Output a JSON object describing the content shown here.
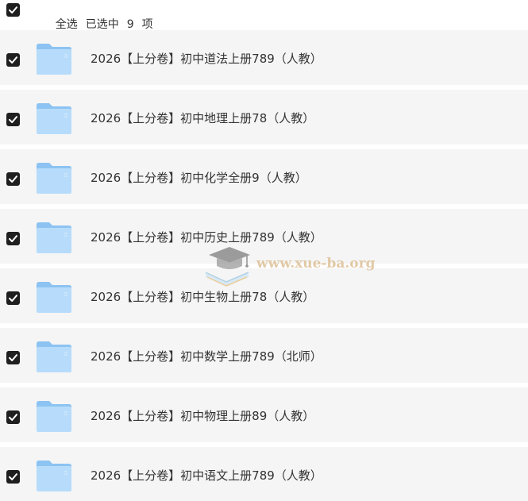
{
  "header": {
    "select_all": "全选",
    "selected": "已选中",
    "count": "9",
    "unit": "项"
  },
  "files": [
    {
      "name": "2026【上分卷】初中道法上册789（人教）",
      "checked": true
    },
    {
      "name": "2026【上分卷】初中地理上册78（人教）",
      "checked": true
    },
    {
      "name": "2026【上分卷】初中化学全册9（人教）",
      "checked": true
    },
    {
      "name": "2026【上分卷】初中历史上册789（人教）",
      "checked": true
    },
    {
      "name": "2026【上分卷】初中生物上册78（人教）",
      "checked": true
    },
    {
      "name": "2026【上分卷】初中数学上册789（北师）",
      "checked": true
    },
    {
      "name": "2026【上分卷】初中物理上册89（人教）",
      "checked": true
    },
    {
      "name": "2026【上分卷】初中语文上册789（人教）",
      "checked": true
    }
  ],
  "icons": {
    "checkbox": "checkbox-checked-icon",
    "folder": "folder-icon",
    "watermark": "graduation-cap-icon"
  },
  "watermark": {
    "text": "www.xue-ba.org"
  },
  "colors": {
    "checkbox": "#1f1f1f",
    "row_background": "#f5f5f5",
    "folder_light": "#b7dcfb",
    "folder_dark": "#8cc3f2",
    "watermark_text": "#d9b98a"
  }
}
